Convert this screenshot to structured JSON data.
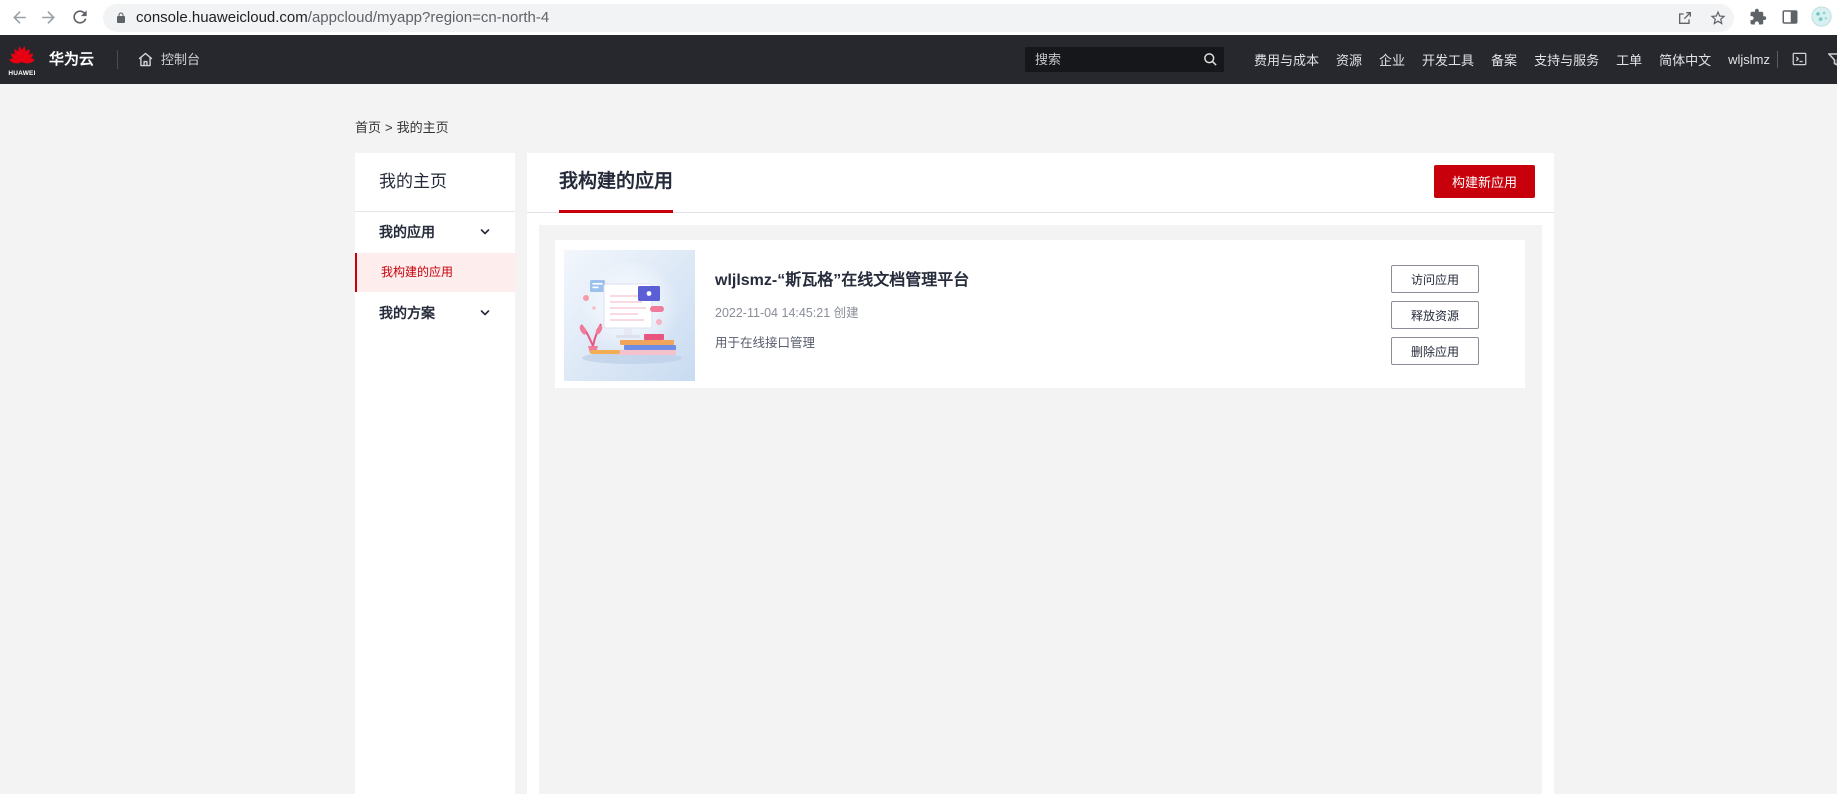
{
  "browser": {
    "url_host": "console.huaweicloud.com",
    "url_path": "/appcloud/myapp?region=cn-north-4",
    "icons": [
      "back-arrow-icon",
      "forward-arrow-icon",
      "reload-icon",
      "lock-icon",
      "share-icon",
      "star-icon",
      "extension-icon",
      "side-panel-icon",
      "profile-avatar-icon"
    ]
  },
  "topnav": {
    "logo_text": "HUAWEI",
    "brand": "华为云",
    "console": "控制台",
    "search_placeholder": "搜索",
    "items": [
      "费用与成本",
      "资源",
      "企业",
      "开发工具",
      "备案",
      "支持与服务",
      "工单",
      "简体中文"
    ],
    "user": "wljslmz",
    "icons": [
      "huawei-logo-icon",
      "home-icon",
      "search-icon",
      "terminal-icon",
      "filter-icon"
    ]
  },
  "breadcrumb": {
    "items": [
      "首页",
      "我的主页"
    ],
    "separator": ">"
  },
  "sidebar": {
    "title": "我的主页",
    "groups": [
      {
        "label": "我的应用",
        "children": [
          {
            "label": "我构建的应用",
            "active": true
          }
        ]
      },
      {
        "label": "我的方案",
        "children": []
      }
    ]
  },
  "main": {
    "title": "我构建的应用",
    "build_button": "构建新应用",
    "apps": [
      {
        "name": "wljlsmz-“斯瓦格”在线文档管理平台",
        "created": "2022-11-04 14:45:21 创建",
        "description": "用于在线接口管理",
        "actions": [
          "访问应用",
          "释放资源",
          "删除应用"
        ]
      }
    ]
  },
  "colors": {
    "accent": "#c7000b",
    "nav_bg": "#26282e",
    "active_bg": "#fdeeed",
    "page_bg": "#f3f3f3"
  }
}
